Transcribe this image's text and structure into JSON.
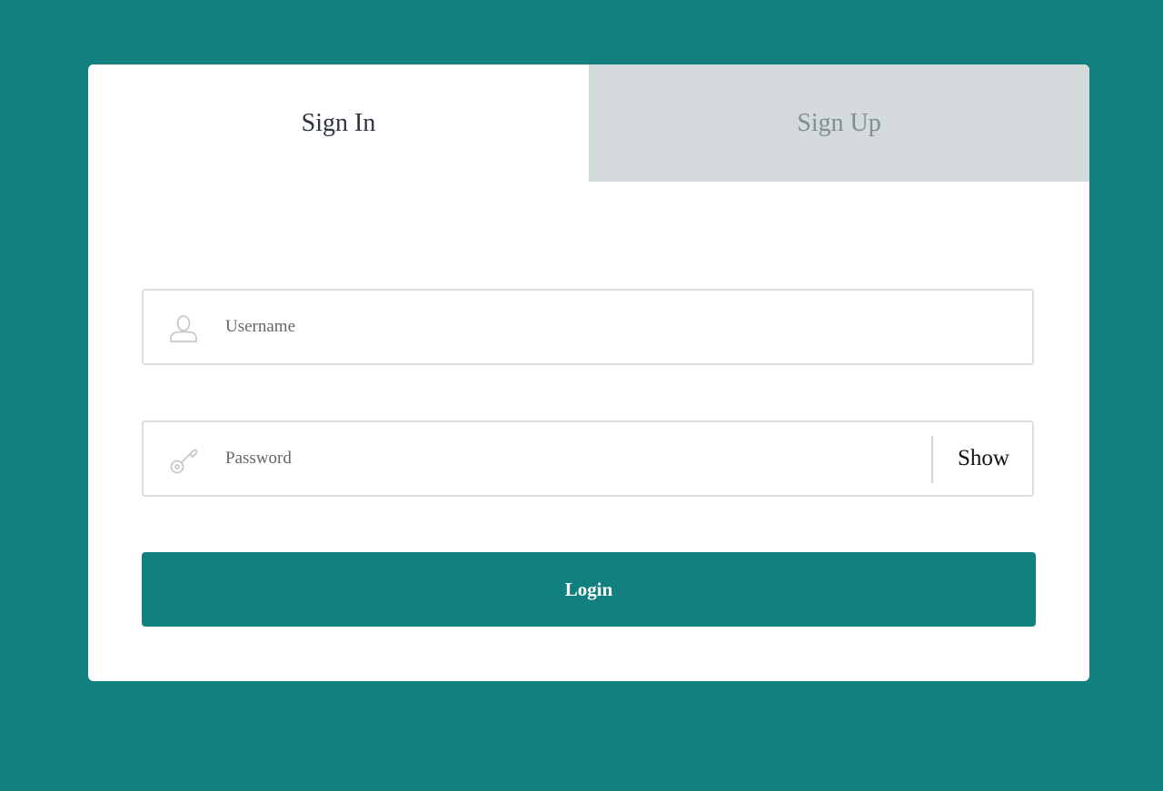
{
  "colors": {
    "background": "#138080",
    "card": "#ffffff",
    "inactive_tab": "#d4dadb",
    "primary_button": "#138080"
  },
  "tabs": [
    {
      "label": "Sign In",
      "active": true
    },
    {
      "label": "Sign Up",
      "active": false
    }
  ],
  "form": {
    "username": {
      "icon": "user-icon",
      "placeholder": "Username",
      "value": ""
    },
    "password": {
      "icon": "key-icon",
      "placeholder": "Password",
      "value": "",
      "show_label": "Show"
    },
    "login_label": "Login"
  }
}
